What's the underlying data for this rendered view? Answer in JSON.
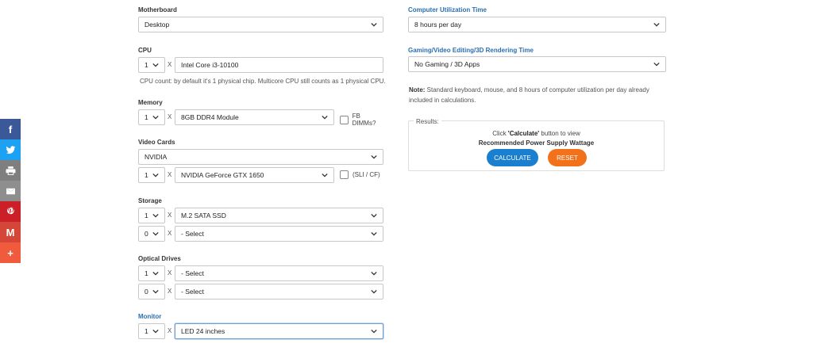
{
  "share": {
    "items": [
      {
        "name": "facebook",
        "color": "#3b5998",
        "glyph": "f"
      },
      {
        "name": "twitter",
        "color": "#1da1f2"
      },
      {
        "name": "print",
        "color": "#7f7f7f"
      },
      {
        "name": "email",
        "color": "#8e8e8e"
      },
      {
        "name": "pinterest",
        "color": "#cb2027"
      },
      {
        "name": "gmail",
        "color": "#d44638",
        "glyph": "M"
      },
      {
        "name": "more",
        "color": "#f05a3d",
        "glyph": "+"
      }
    ]
  },
  "left": {
    "motherboard": {
      "label": "Motherboard",
      "value": "Desktop"
    },
    "cpu": {
      "label": "CPU",
      "qty": "1",
      "x": "X",
      "value": "Intel Core i3-10100",
      "note": "CPU count: by default it's 1 physical chip. Multicore CPU still counts as 1 physical CPU."
    },
    "memory": {
      "label": "Memory",
      "qty": "1",
      "x": "X",
      "value": "8GB DDR4 Module",
      "checkbox": "FB DIMMs?"
    },
    "video": {
      "label": "Video Cards",
      "brand": "NVIDIA",
      "qty": "1",
      "x": "X",
      "value": "NVIDIA GeForce GTX 1650",
      "checkbox": "(SLI / CF)"
    },
    "storage": {
      "label": "Storage",
      "rows": [
        {
          "qty": "1",
          "x": "X",
          "value": "M.2 SATA SSD"
        },
        {
          "qty": "0",
          "x": "X",
          "value": "- Select"
        }
      ]
    },
    "optical": {
      "label": "Optical Drives",
      "rows": [
        {
          "qty": "1",
          "x": "X",
          "value": "- Select"
        },
        {
          "qty": "0",
          "x": "X",
          "value": "- Select"
        }
      ]
    },
    "monitor": {
      "label": "Monitor",
      "qty": "1",
      "x": "X",
      "value": "LED 24 inches"
    }
  },
  "right": {
    "utilization": {
      "label": "Computer Utilization Time",
      "value": "8 hours per day"
    },
    "gaming": {
      "label": "Gaming/Video Editing/3D Rendering Time",
      "value": "No Gaming / 3D Apps"
    },
    "note_bold": "Note:",
    "note_text": " Standard keyboard, mouse, and 8 hours of computer utilization per day already included in calculations.",
    "results": {
      "legend": "Results:",
      "msg_pre": "Click ",
      "msg_bold": "'Calculate'",
      "msg_post": " button to view",
      "sub": "Recommended Power Supply Wattage",
      "calculate": "CALCULATE",
      "reset": "RESET"
    }
  }
}
